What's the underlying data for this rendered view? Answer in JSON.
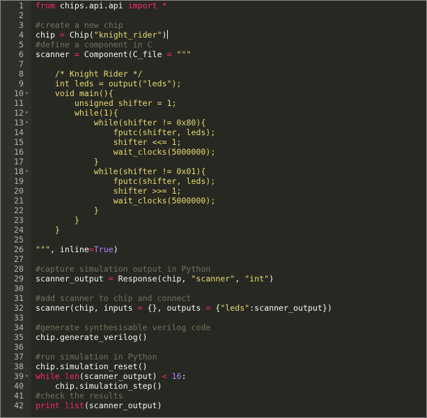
{
  "editor": {
    "lines": [
      {
        "n": "1",
        "fold": "",
        "segs": [
          [
            "k",
            "from"
          ],
          [
            "p",
            " chips.api.api "
          ],
          [
            "k",
            "import"
          ],
          [
            "p",
            " "
          ],
          [
            "k",
            "*"
          ]
        ]
      },
      {
        "n": "2",
        "fold": "",
        "segs": []
      },
      {
        "n": "3",
        "fold": "",
        "segs": [
          [
            "c",
            "#create a new chip"
          ]
        ]
      },
      {
        "n": "4",
        "fold": "",
        "segs": [
          [
            "p",
            "chip "
          ],
          [
            "k",
            "="
          ],
          [
            "p",
            " Chip("
          ],
          [
            "s",
            "\"knight_rider\""
          ],
          [
            "p",
            ")"
          ]
        ],
        "cursor": true
      },
      {
        "n": "5",
        "fold": "",
        "segs": [
          [
            "c",
            "#define a component in C"
          ]
        ]
      },
      {
        "n": "6",
        "fold": "",
        "segs": [
          [
            "p",
            "scanner "
          ],
          [
            "k",
            "="
          ],
          [
            "p",
            " Component(C_file "
          ],
          [
            "k",
            "="
          ],
          [
            "p",
            " "
          ],
          [
            "s",
            "\"\"\""
          ]
        ]
      },
      {
        "n": "7",
        "fold": "",
        "segs": []
      },
      {
        "n": "8",
        "fold": "",
        "segs": [
          [
            "s",
            "    /* Knight Rider */"
          ]
        ]
      },
      {
        "n": "9",
        "fold": "",
        "segs": [
          [
            "s",
            "    int leds = output(\"leds\");"
          ]
        ]
      },
      {
        "n": "10",
        "fold": "▾",
        "segs": [
          [
            "s",
            "    void main(){"
          ]
        ]
      },
      {
        "n": "11",
        "fold": "",
        "segs": [
          [
            "s",
            "        unsigned shifter = 1;"
          ]
        ]
      },
      {
        "n": "12",
        "fold": "▾",
        "segs": [
          [
            "s",
            "        while(1){"
          ]
        ]
      },
      {
        "n": "13",
        "fold": "▾",
        "segs": [
          [
            "s",
            "            while(shifter != 0x80){"
          ]
        ]
      },
      {
        "n": "14",
        "fold": "",
        "segs": [
          [
            "s",
            "                fputc(shifter, leds);"
          ]
        ]
      },
      {
        "n": "15",
        "fold": "",
        "segs": [
          [
            "s",
            "                shifter <<= 1;"
          ]
        ]
      },
      {
        "n": "16",
        "fold": "",
        "segs": [
          [
            "s",
            "                wait_clocks(5000000);"
          ]
        ]
      },
      {
        "n": "17",
        "fold": "",
        "segs": [
          [
            "s",
            "            }"
          ]
        ]
      },
      {
        "n": "18",
        "fold": "▾",
        "segs": [
          [
            "s",
            "            while(shifter != 0x01){"
          ]
        ]
      },
      {
        "n": "19",
        "fold": "",
        "segs": [
          [
            "s",
            "                fputc(shifter, leds);"
          ]
        ]
      },
      {
        "n": "20",
        "fold": "",
        "segs": [
          [
            "s",
            "                shifter >>= 1;"
          ]
        ]
      },
      {
        "n": "21",
        "fold": "",
        "segs": [
          [
            "s",
            "                wait_clocks(5000000);"
          ]
        ]
      },
      {
        "n": "22",
        "fold": "",
        "segs": [
          [
            "s",
            "            }"
          ]
        ]
      },
      {
        "n": "23",
        "fold": "",
        "segs": [
          [
            "s",
            "        }"
          ]
        ]
      },
      {
        "n": "24",
        "fold": "",
        "segs": [
          [
            "s",
            "    }"
          ]
        ]
      },
      {
        "n": "25",
        "fold": "",
        "segs": []
      },
      {
        "n": "26",
        "fold": "",
        "segs": [
          [
            "s",
            "\"\"\""
          ],
          [
            "p",
            ", inline"
          ],
          [
            "k",
            "="
          ],
          [
            "n",
            "True"
          ],
          [
            "p",
            ")"
          ]
        ]
      },
      {
        "n": "27",
        "fold": "",
        "segs": []
      },
      {
        "n": "28",
        "fold": "",
        "segs": [
          [
            "c",
            "#capture simulation output in Python"
          ]
        ]
      },
      {
        "n": "29",
        "fold": "",
        "segs": [
          [
            "p",
            "scanner_output "
          ],
          [
            "k",
            "="
          ],
          [
            "p",
            " Response(chip, "
          ],
          [
            "s",
            "\"scanner\""
          ],
          [
            "p",
            ", "
          ],
          [
            "s",
            "\"int\""
          ],
          [
            "p",
            ")"
          ]
        ]
      },
      {
        "n": "30",
        "fold": "",
        "segs": []
      },
      {
        "n": "31",
        "fold": "",
        "segs": [
          [
            "c",
            "#add scanner to chip and connect"
          ]
        ]
      },
      {
        "n": "32",
        "fold": "",
        "segs": [
          [
            "p",
            "scanner(chip, inputs "
          ],
          [
            "k",
            "="
          ],
          [
            "p",
            " {}, outputs "
          ],
          [
            "k",
            "="
          ],
          [
            "p",
            " {"
          ],
          [
            "s",
            "\"leds\""
          ],
          [
            "p",
            ":scanner_output})"
          ]
        ]
      },
      {
        "n": "33",
        "fold": "",
        "segs": []
      },
      {
        "n": "34",
        "fold": "",
        "segs": [
          [
            "c",
            "#generate synthesisable verilog code"
          ]
        ]
      },
      {
        "n": "35",
        "fold": "",
        "segs": [
          [
            "p",
            "chip.generate_verilog()"
          ]
        ]
      },
      {
        "n": "36",
        "fold": "",
        "segs": []
      },
      {
        "n": "37",
        "fold": "",
        "segs": [
          [
            "c",
            "#run simulation in Python"
          ]
        ]
      },
      {
        "n": "38",
        "fold": "",
        "segs": [
          [
            "p",
            "chip.simulation_reset()"
          ]
        ]
      },
      {
        "n": "39",
        "fold": "▾",
        "segs": [
          [
            "k",
            "while"
          ],
          [
            "p",
            " "
          ],
          [
            "k",
            "len"
          ],
          [
            "p",
            "(scanner_output) "
          ],
          [
            "k",
            "<"
          ],
          [
            "p",
            " "
          ],
          [
            "n",
            "16"
          ],
          [
            "p",
            ":"
          ]
        ]
      },
      {
        "n": "40",
        "fold": "",
        "segs": [
          [
            "p",
            "    chip.simulation_step()"
          ]
        ]
      },
      {
        "n": "41",
        "fold": "",
        "segs": [
          [
            "c",
            "#check the results"
          ]
        ]
      },
      {
        "n": "42",
        "fold": "",
        "segs": [
          [
            "k",
            "print"
          ],
          [
            "p",
            " "
          ],
          [
            "k",
            "list"
          ],
          [
            "p",
            "(scanner_output)"
          ]
        ]
      }
    ]
  },
  "colors": {
    "background": "#272822",
    "gutter": "#2f302a",
    "keyword": "#f92672",
    "string": "#e6db74",
    "comment": "#75715e",
    "constant": "#ae81ff",
    "plain": "#f8f8f2",
    "line_number": "#b4b4aa"
  }
}
